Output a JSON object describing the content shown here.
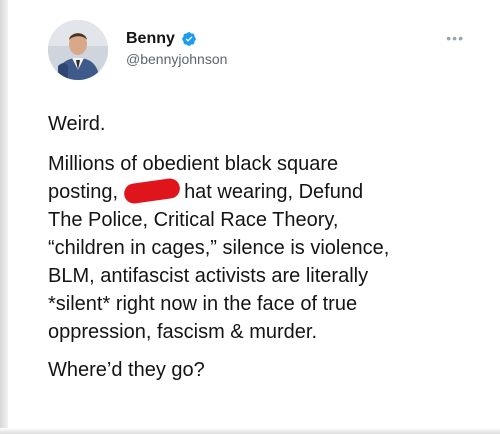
{
  "author": {
    "name": "Benny",
    "handle": "@bennyjohnson"
  },
  "icons": {
    "verified": "verified-badge-icon",
    "more": "more-options-icon",
    "avatar": "profile-photo"
  },
  "colors": {
    "verified_blue": "#1d9bf0",
    "redaction_red": "#e0141b",
    "handle_gray": "#5b6670"
  },
  "tweet": {
    "p1": "Weird.",
    "p2_line1_a": "Millions of obedient black square",
    "p2_line2_a": "posting,",
    "p2_line2_b": "hat wearing, Defund",
    "p2_line3": "The Police, Critical Race Theory,",
    "p2_line4": "“children in cages,” silence is violence,",
    "p2_line5": "BLM, antifascist activists are literally",
    "p2_line6": "*silent* right now in the face of true",
    "p2_line7": "oppression, fascism & murder.",
    "p3": "Where’d they go?"
  }
}
